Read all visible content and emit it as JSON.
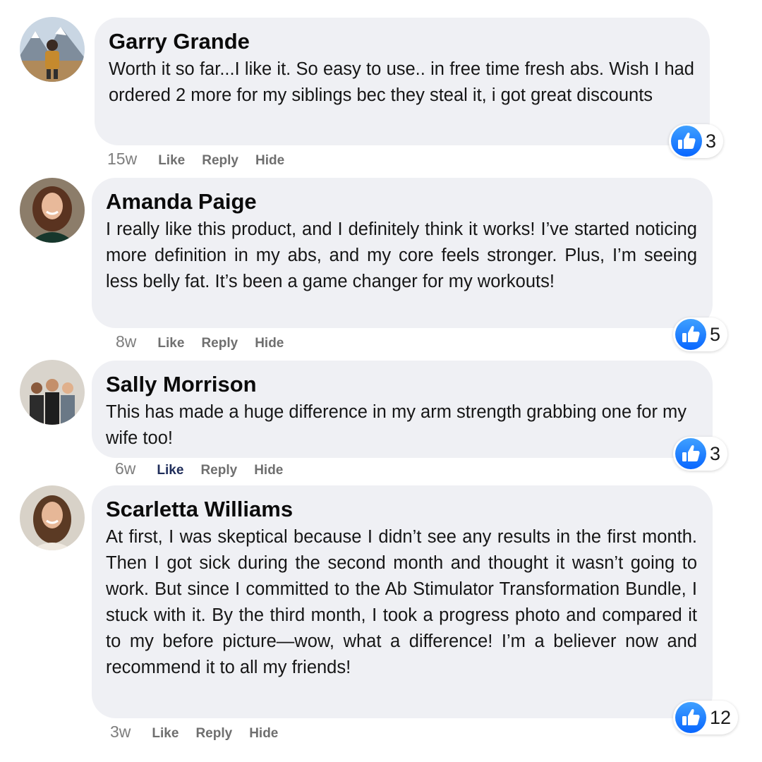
{
  "comments": [
    {
      "name": "Garry Grande",
      "text": "Worth it so far...I like it. So easy to use.. in free time fresh abs. Wish I had ordered 2 more for my siblings bec they steal it, i got great discounts",
      "age": "15w",
      "actions": [
        "Like",
        "Reply",
        "Hide"
      ],
      "likes": "3",
      "avatar_icon": "mountain-hiker-avatar"
    },
    {
      "name": "Amanda Paige",
      "text": "I really like this product, and I definitely think it works! I’ve started noticing more definition in my abs, and my core feels stronger. Plus, I’m seeing less belly fat. It’s been a game changer for my workouts!",
      "age": "8w",
      "actions": [
        "Like",
        "Reply",
        "Hide"
      ],
      "likes": "5",
      "avatar_icon": "woman-portrait-avatar"
    },
    {
      "name": "Sally Morrison",
      "text": "This has made a huge difference in my arm strength grabbing one for my wife too!",
      "age": "6w",
      "actions": [
        "Like",
        "Reply",
        "Hide"
      ],
      "likes": "3",
      "avatar_icon": "group-photo-avatar"
    },
    {
      "name": "Scarletta Williams",
      "text": "At first, I was skeptical because I didn’t see any results in the first month. Then I got sick during the second month and thought it wasn’t going to work. But since I committed to the Ab Stimulator Transformation Bundle, I stuck with it. By the third month, I took a progress photo and compared it to my before picture—wow, what a difference! I’m a believer now and recommend it to all my friends!",
      "age": "3w",
      "actions": [
        "Like",
        "Reply",
        "Hide"
      ],
      "likes": "12",
      "avatar_icon": "woman-smiling-avatar"
    }
  ],
  "colors": {
    "bubble": "#eff0f4",
    "like_blue_light": "#3fa0ff",
    "like_blue_dark": "#0866ff"
  }
}
